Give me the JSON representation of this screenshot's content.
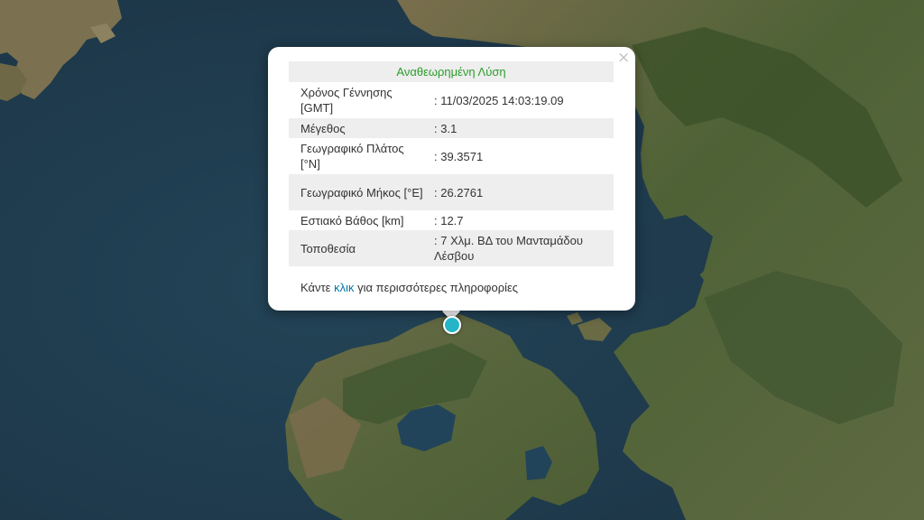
{
  "popup": {
    "title": "Αναθεωρημένη Λύση",
    "close_symbol": "×",
    "rows": [
      {
        "label": "Χρόνος Γέννησης [GMT]",
        "value": ": 11/03/2025 14:03:19.09"
      },
      {
        "label": "Μέγεθος",
        "value": ": 3.1"
      },
      {
        "label": "Γεωγραφικό Πλάτος [°N]",
        "value": ": 39.3571"
      },
      {
        "label": "Γεωγραφικό Μήκος [°E]",
        "value": ": 26.2761"
      },
      {
        "label": "Εστιακό Βάθος [km]",
        "value": ": 12.7"
      },
      {
        "label": "Τοποθεσία",
        "value": ": 7 Χλμ. ΒΔ του Μανταμάδου Λέσβου"
      }
    ],
    "more_prefix": "Κάντε ",
    "more_link": "κλικ",
    "more_suffix": " για περισσότερες πληροφορίες"
  },
  "marker": {
    "icon": "epicenter-marker-icon",
    "color": "#25b5c8"
  },
  "colors": {
    "sea": "#1f3a4b",
    "land": "#5a6a3e",
    "title_green": "#2a9c2a",
    "link_blue": "#0078a8"
  }
}
